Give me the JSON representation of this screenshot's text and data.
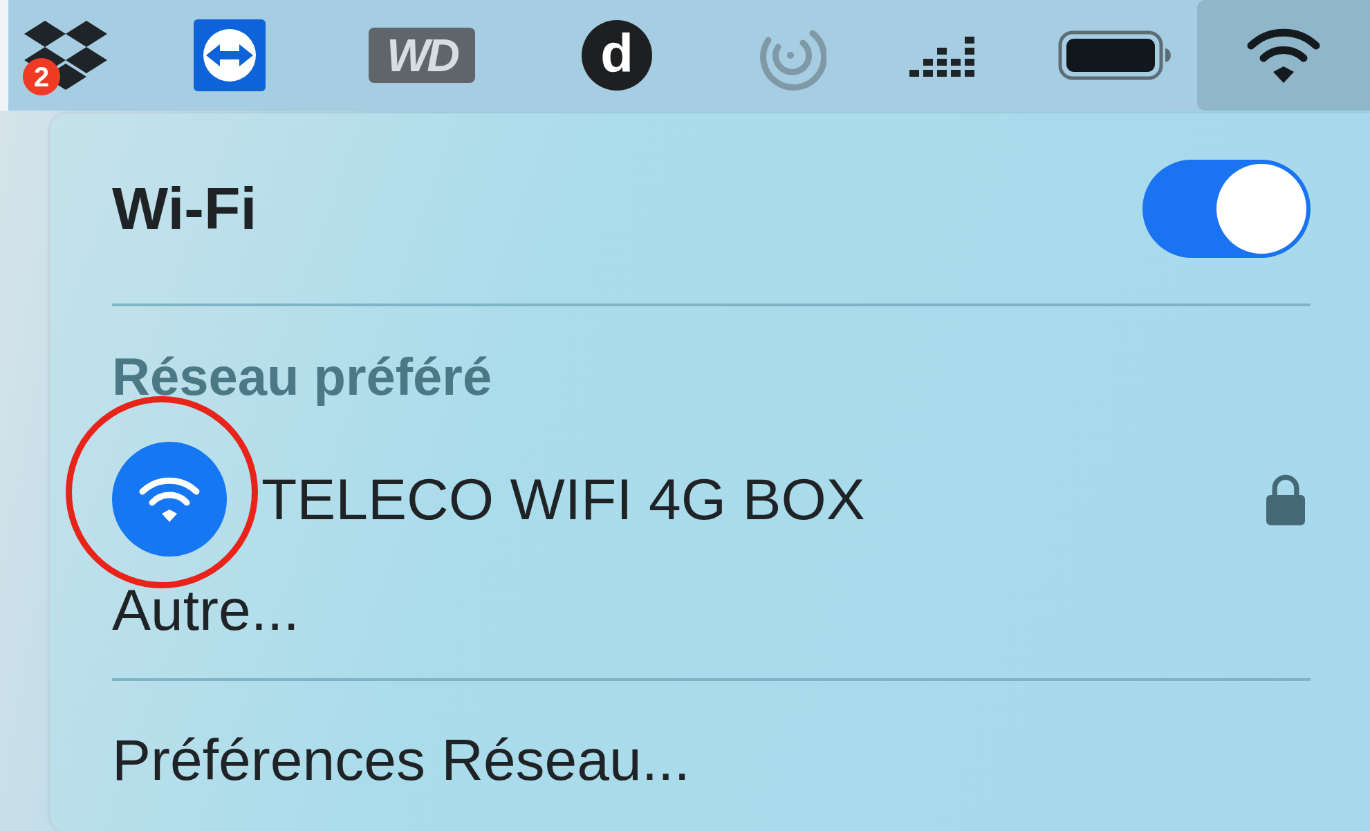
{
  "menu_bar": {
    "items": [
      {
        "kind": "dropbox",
        "badge": "2",
        "selected": false
      },
      {
        "kind": "teamviewer",
        "selected": false
      },
      {
        "kind": "drive",
        "label": "WD",
        "selected": false
      },
      {
        "kind": "letter",
        "label": "d",
        "selected": false
      },
      {
        "kind": "spiral",
        "selected": false
      },
      {
        "kind": "meter",
        "selected": false
      },
      {
        "kind": "battery",
        "selected": false
      },
      {
        "kind": "wifi",
        "selected": true
      }
    ]
  },
  "wifi_menu": {
    "title": "Wi-Fi",
    "toggle": {
      "on": true
    },
    "section_heading": "Réseau préféré",
    "networks": [
      {
        "name": "TELECO WIFI 4G BOX",
        "locked": true,
        "selected": true,
        "highlighted": true
      }
    ],
    "items": [
      "Autre...",
      "Préférences Réseau..."
    ]
  }
}
